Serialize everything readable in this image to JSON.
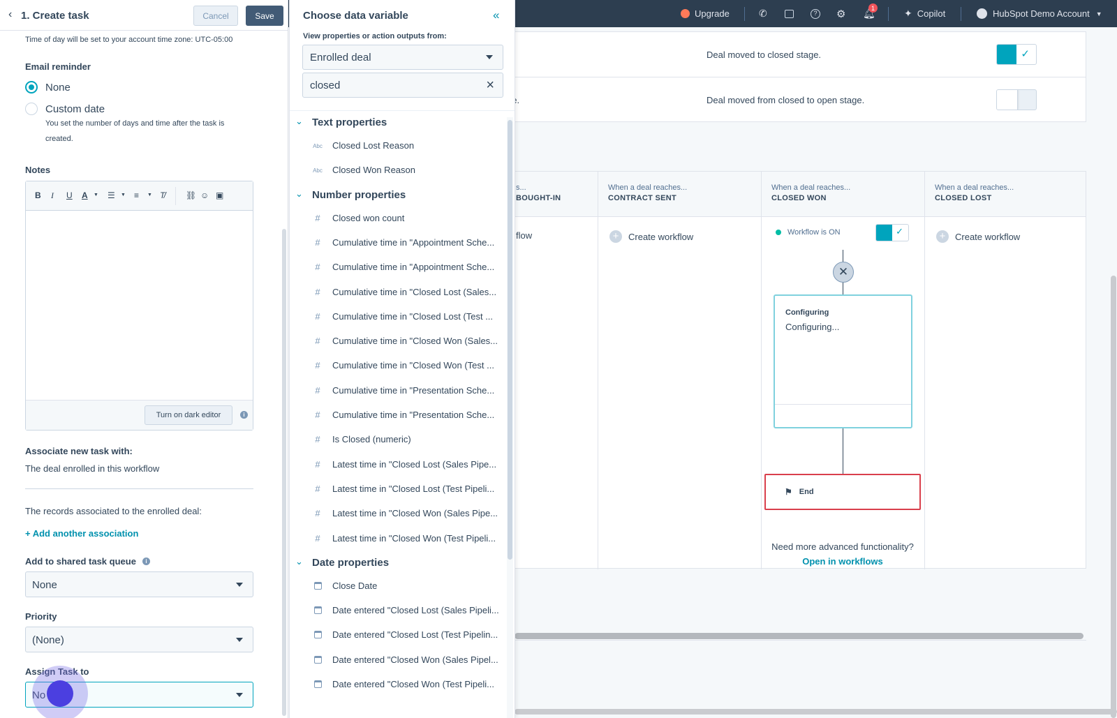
{
  "topnav": {
    "upgrade": "Upgrade",
    "copilot": "Copilot",
    "account": "HubSpot Demo Account",
    "notifications_count": "1"
  },
  "board": {
    "trigger_rows": [
      {
        "fragment": ").",
        "description": "Deal moved to closed stage.",
        "toggle_on": true
      },
      {
        "fragment": "ge.",
        "description": "Deal moved from closed to open stage.",
        "toggle_on": false
      }
    ],
    "stages": [
      {
        "when": "s...",
        "stage": "BOUGHT-IN",
        "action": "flow"
      },
      {
        "when": "When a deal reaches...",
        "stage": "CONTRACT SENT",
        "action": "Create workflow"
      },
      {
        "when": "When a deal reaches...",
        "stage": "CLOSED WON",
        "action": "Workflow is ON"
      },
      {
        "when": "When a deal reaches...",
        "stage": "CLOSED LOST",
        "action": "Create workflow"
      }
    ],
    "config_title": "Configuring",
    "config_sub": "Configuring...",
    "end_label": "End",
    "need_more": "Need more advanced functionality?",
    "open_link": "Open in workflows"
  },
  "left": {
    "title": "1. Create task",
    "cancel": "Cancel",
    "save": "Save",
    "timezone_note": "Time of day will be set to your account time zone: UTC-05:00",
    "email_reminder_label": "Email reminder",
    "radio_none": "None",
    "radio_custom": "Custom date",
    "custom_help_1": "You set the number of days and time after the task is",
    "custom_help_2": "created.",
    "notes_label": "Notes",
    "dark_editor": "Turn on dark editor",
    "associate_label": "Associate new task with:",
    "associate_value": "The deal enrolled in this workflow",
    "records_note": "The records associated to the enrolled deal:",
    "add_association": "+ Add another association",
    "queue_label": "Add to shared task queue",
    "queue_value": "None",
    "priority_label": "Priority",
    "priority_value": "(None)",
    "assign_label": "Assign Task to",
    "assign_value": "No"
  },
  "dv": {
    "title": "Choose data variable",
    "sub": "View properties or action outputs from:",
    "source": "Enrolled deal",
    "search": "closed",
    "groups": [
      {
        "name": "Text properties",
        "icon": "abc-icon",
        "items": [
          "Closed Lost Reason",
          "Closed Won Reason"
        ]
      },
      {
        "name": "Number properties",
        "icon": "hash-icon",
        "items": [
          "Closed won count",
          "Cumulative time in \"Appointment Sche...",
          "Cumulative time in \"Appointment Sche...",
          "Cumulative time in \"Closed Lost (Sales...",
          "Cumulative time in \"Closed Lost (Test ...",
          "Cumulative time in \"Closed Won (Sales...",
          "Cumulative time in \"Closed Won (Test ...",
          "Cumulative time in \"Presentation Sche...",
          "Cumulative time in \"Presentation Sche...",
          "Is Closed (numeric)",
          "Latest time in \"Closed Lost (Sales Pipe...",
          "Latest time in \"Closed Lost (Test Pipeli...",
          "Latest time in \"Closed Won (Sales Pipe...",
          "Latest time in \"Closed Won (Test Pipeli..."
        ]
      },
      {
        "name": "Date properties",
        "icon": "calendar-icon",
        "items": [
          "Close Date",
          "Date entered \"Closed Lost (Sales Pipeli...",
          "Date entered \"Closed Lost (Test Pipelin...",
          "Date entered \"Closed Won (Sales Pipel...",
          "Date entered \"Closed Won (Test Pipeli..."
        ]
      }
    ]
  },
  "colors": {
    "nav": "#2d3e50",
    "accent": "#00a4bd",
    "link": "#0091ae",
    "end_border": "#d93f4c"
  }
}
